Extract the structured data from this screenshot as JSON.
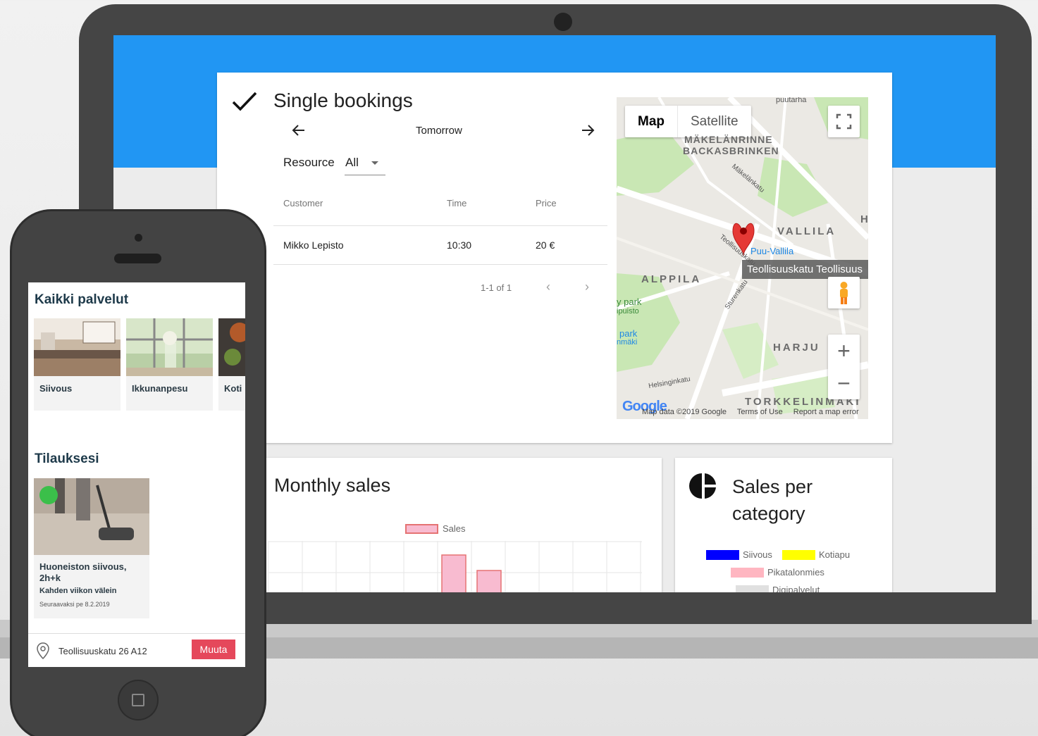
{
  "booking": {
    "title": "Single bookings",
    "date_label": "Tomorrow",
    "resource_label": "Resource",
    "resource_value": "All",
    "columns": [
      "Customer",
      "Time",
      "Price"
    ],
    "rows": [
      {
        "customer": "Mikko Lepisto",
        "time": "10:30",
        "price": "20 €"
      }
    ],
    "pager_text": "1-1 of 1"
  },
  "map": {
    "tab_map": "Map",
    "tab_satellite": "Satellite",
    "labels": [
      "MÄKELÄNRINNE",
      "BACKASBRINKEN",
      "VALLILA",
      "ALPPILA",
      "HARJU",
      "TORKKELINMÄKI",
      "H"
    ],
    "streets": [
      "Mäkelänkatu",
      "Teollisuuskatu",
      "Sturenkatu",
      "Helsinginkatu",
      "puutarha",
      "y park",
      "ipuisto",
      "park",
      "nmäki"
    ],
    "poi": "Puu-Vallila",
    "tooltip": "Teollisuuskatu Teollisuus",
    "google": "Google",
    "footer": {
      "data": "Map data ©2019 Google",
      "terms": "Terms of Use",
      "report": "Report a map error"
    }
  },
  "sales": {
    "title": "Monthly sales",
    "legend": "Sales",
    "color": "#f8bbd0",
    "border": "#e57373"
  },
  "category": {
    "title": "Sales per category",
    "legend": [
      {
        "name": "Siivous",
        "color": "#0000ff"
      },
      {
        "name": "Kotiapu",
        "color": "#ffff00"
      },
      {
        "name": "Pikatalonmies",
        "color": "#ffb6c1"
      },
      {
        "name": "Digipalvelut",
        "color": "#e0e0e0"
      }
    ]
  },
  "phone": {
    "services_heading": "Kaikki palvelut",
    "services": [
      "Siivous",
      "Ikkunanpesu",
      "Koti"
    ],
    "orders_heading": "Tilauksesi",
    "order": {
      "title": "Huoneiston siivous, 2h+k",
      "frequency": "Kahden viikon välein",
      "next": "Seuraavaksi pe 8.2.2019"
    },
    "address": "Teollisuuskatu 26 A12",
    "change_button": "Muuta"
  },
  "colors": {
    "header_blue": "#2196f3",
    "accent_red": "#e5485b"
  }
}
